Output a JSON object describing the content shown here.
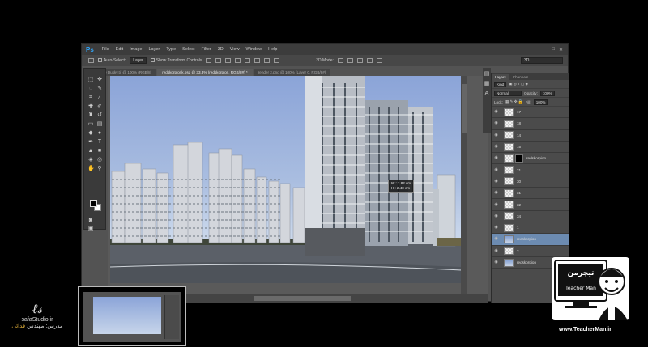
{
  "app": {
    "logo": "Ps",
    "menu": [
      "File",
      "Edit",
      "Image",
      "Layer",
      "Type",
      "Select",
      "Filter",
      "3D",
      "View",
      "Window",
      "Help"
    ]
  },
  "options": {
    "auto_select_label": "Auto-Select:",
    "auto_select_value": "Layer",
    "show_transform_label": "Show Transform Controls",
    "mode_3d_label": "3D Mode:",
    "workspace_value": "3D"
  },
  "doc_tabs": [
    "0 Dusky.tif @ 100% (RGB/8)",
    "redskorpionk.psd @ 33.3% (redskorpion, RGB/8#) *",
    "render 2.png @ 100% (Layer 0, RGB/8#)"
  ],
  "ruler_tooltip": {
    "w": "W : 1.82 cm",
    "h": "H : 2.40 cm"
  },
  "layers_panel": {
    "tabs": [
      "Layers",
      "Channels"
    ],
    "kind_label": "Kind",
    "blend_mode": "Normal",
    "opacity_label": "Opacity:",
    "opacity_value": "100%",
    "lock_label": "Lock:",
    "fill_label": "Fill:",
    "fill_value": "100%",
    "layers": [
      {
        "name": "17",
        "selected": false,
        "mask": false,
        "img": false
      },
      {
        "name": "18",
        "selected": false,
        "mask": false,
        "img": false
      },
      {
        "name": "14",
        "selected": false,
        "mask": false,
        "img": false
      },
      {
        "name": "15",
        "selected": false,
        "mask": false,
        "img": false
      },
      {
        "name": "redskorpion",
        "selected": false,
        "mask": true,
        "img": false
      },
      {
        "name": "21",
        "selected": false,
        "mask": false,
        "img": false
      },
      {
        "name": "30",
        "selected": false,
        "mask": false,
        "img": false
      },
      {
        "name": "31",
        "selected": false,
        "mask": false,
        "img": false
      },
      {
        "name": "32",
        "selected": false,
        "mask": false,
        "img": false
      },
      {
        "name": "34",
        "selected": false,
        "mask": false,
        "img": false
      },
      {
        "name": "1",
        "selected": false,
        "mask": false,
        "img": false
      },
      {
        "name": "redskorpion",
        "selected": true,
        "mask": false,
        "img": true
      },
      {
        "name": "2",
        "selected": false,
        "mask": false,
        "img": false
      },
      {
        "name": "redskorpion",
        "selected": false,
        "mask": false,
        "img": true
      }
    ]
  },
  "watermark_left": {
    "site": "safaStudio.ir",
    "teacher_prefix": "مدرس: مهندس",
    "teacher_name": "فدائی"
  },
  "watermark_right": {
    "brand_fa": "تیچرمن",
    "brand_en": "Teacher Man",
    "site": "www.TeacherMan.ir"
  }
}
